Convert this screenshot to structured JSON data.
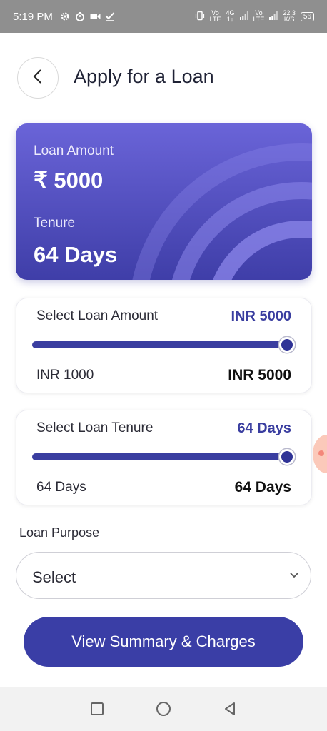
{
  "status_bar": {
    "time": "5:19 PM",
    "icons": [
      "gear-icon",
      "timer-icon",
      "video-camera-icon",
      "check-icon"
    ],
    "vibrate_icon": "vibrate-icon",
    "net1_top": "Vo",
    "net1_bottom": "LTE",
    "net2_top": "4G",
    "net2_bottom": "1↓",
    "net3_top": "Vo",
    "net3_bottom": "LTE",
    "speed_value": "22.3",
    "speed_unit": "K/S",
    "battery": "56"
  },
  "header": {
    "title": "Apply for a Loan",
    "back_icon": "chevron-left-icon"
  },
  "summary_card": {
    "amount_label": "Loan Amount",
    "amount_value": "₹ 5000",
    "tenure_label": "Tenure",
    "tenure_value": "64 Days",
    "colors": {
      "gradient_top": "#6a64d8",
      "gradient_bottom": "#3f3ea8"
    }
  },
  "loan_amount_slider": {
    "title": "Select Loan Amount",
    "current": "INR 5000",
    "min_label": "INR 1000",
    "max_label": "INR 5000",
    "min": 1000,
    "max": 5000,
    "value": 5000
  },
  "loan_tenure_slider": {
    "title": "Select Loan Tenure",
    "current": "64 Days",
    "min_label": "64 Days",
    "max_label": "64 Days",
    "fill_fraction": 1.0
  },
  "loan_purpose": {
    "label": "Loan Purpose",
    "selected": "Select",
    "chevron_icon": "chevron-down-icon"
  },
  "cta": {
    "label": "View Summary & Charges"
  },
  "nav_bar": {
    "icons": [
      "recent-apps-icon",
      "home-icon",
      "back-icon"
    ]
  },
  "colors": {
    "accent": "#3a3ea6",
    "status_bar": "#8f8f8f"
  }
}
